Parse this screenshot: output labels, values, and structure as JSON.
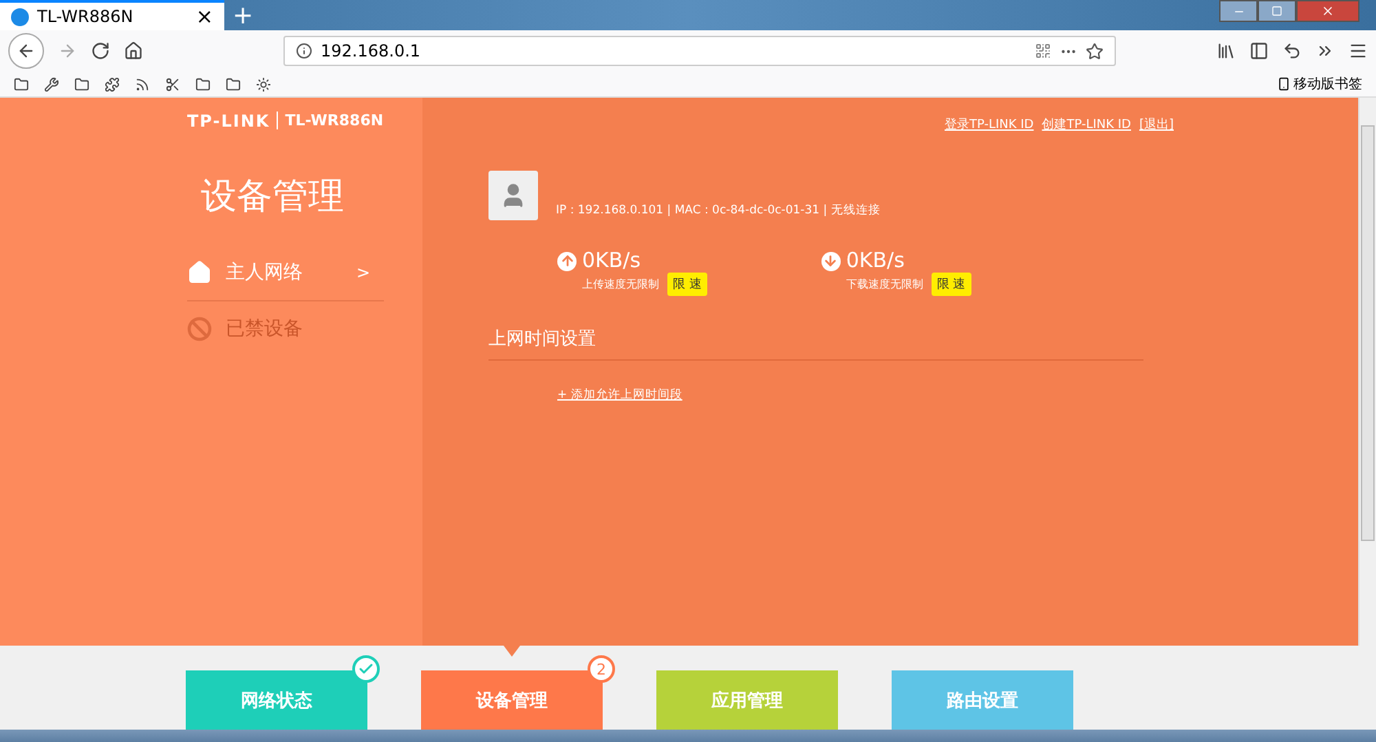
{
  "browser": {
    "tab_title": "TL-WR886N",
    "tab_close": "×",
    "new_tab": "+",
    "address": "192.168.0.1",
    "bookmark_folder": "移动版书签"
  },
  "header": {
    "logo": "TP-LINK",
    "model": "TL-WR886N",
    "links": [
      {
        "label": "登录TP-LINK ID"
      },
      {
        "label": "创建TP-LINK ID"
      },
      {
        "label": "[退出]"
      }
    ]
  },
  "sidebar": {
    "title": "设备管理",
    "items": [
      {
        "label": "主人网络",
        "kind": "home",
        "arrow": ">",
        "disabled": false
      },
      {
        "label": "已禁设备",
        "kind": "ban",
        "disabled": true
      }
    ]
  },
  "device": {
    "info": "IP : 192.168.0.101 | MAC : 0c-84-dc-0c-01-31 | 无线连接"
  },
  "speeds": [
    {
      "kind": "up",
      "value": "0KB/s",
      "caption": "上传速度无限制",
      "button": "限 速"
    },
    {
      "kind": "down",
      "value": "0KB/s",
      "caption": "下载速度无限制",
      "button": "限 速"
    }
  ],
  "schedule": {
    "title": "上网时间设置",
    "add_link": "+ 添加允许上网时间段"
  },
  "nav_tiles": [
    {
      "label": "网络状态",
      "color": "#1ecfb8",
      "selected": false,
      "kind": "check"
    },
    {
      "label": "设备管理",
      "color": "#fe784a",
      "selected": true,
      "kind": "count",
      "badge": "2"
    },
    {
      "label": "应用管理",
      "color": "#b6d23a",
      "selected": false,
      "kind": "plain"
    },
    {
      "label": "路由设置",
      "color": "#5ec4e6",
      "selected": false,
      "kind": "plain"
    }
  ]
}
